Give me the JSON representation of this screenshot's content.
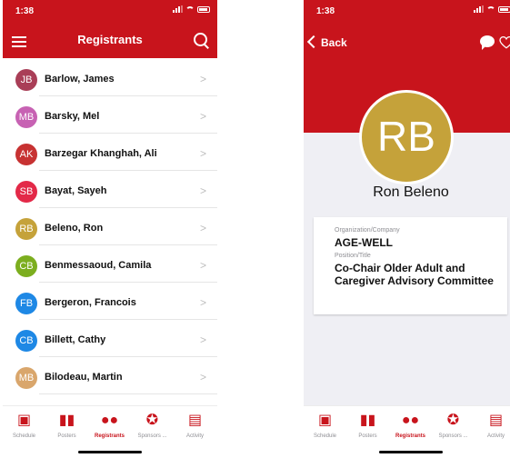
{
  "colors": {
    "accent": "#c8141c",
    "chevron": "#bdbdbd",
    "tab_inactive": "#8e8e93"
  },
  "left_screen": {
    "status_time": "1:38",
    "header_title": "Registrants",
    "icons": {
      "menu": "hamburger-icon",
      "search": "search-icon"
    },
    "registrants": [
      {
        "initials": "JB",
        "name": "Barlow, James",
        "color": "#a93e57"
      },
      {
        "initials": "MB",
        "name": "Barsky, Mel",
        "color": "#c762b3"
      },
      {
        "initials": "AK",
        "name": "Barzegar Khanghah, Ali",
        "color": "#c73232"
      },
      {
        "initials": "SB",
        "name": "Bayat, Sayeh",
        "color": "#e32948"
      },
      {
        "initials": "RB",
        "name": "Beleno, Ron",
        "color": "#c5a23a"
      },
      {
        "initials": "CB",
        "name": "Benmessaoud, Camila",
        "color": "#7cae1f"
      },
      {
        "initials": "FB",
        "name": "Bergeron, Francois",
        "color": "#1e88e5"
      },
      {
        "initials": "CB",
        "name": "Billett, Cathy",
        "color": "#1e88e5"
      },
      {
        "initials": "MB",
        "name": "Bilodeau, Martin",
        "color": "#d9a66c"
      }
    ]
  },
  "tabs": [
    {
      "label": "Schedule",
      "icon": "calendar-icon",
      "glyph": "▣",
      "active": false
    },
    {
      "label": "Posters",
      "icon": "posters-icon",
      "glyph": "▮▮",
      "active": false
    },
    {
      "label": "Registrants",
      "icon": "people-icon",
      "glyph": "●●",
      "active": true
    },
    {
      "label": "Sponsors ...",
      "icon": "award-icon",
      "glyph": "✪",
      "active": false
    },
    {
      "label": "Activity",
      "icon": "newspaper-icon",
      "glyph": "▤",
      "active": false
    }
  ],
  "right_screen": {
    "status_time": "1:38",
    "back_label": "Back",
    "icons": {
      "chat": "chat-bubble-icon",
      "favorite": "heart-icon"
    },
    "initials": "RB",
    "avatar_color": "#c5a23a",
    "full_name": "Ron Beleno",
    "details": {
      "organization_label": "Organization/Company",
      "organization_value": "AGE-WELL",
      "position_label": "Position/Title",
      "position_value": "Co-Chair Older Adult and Caregiver Advisory Committee"
    }
  }
}
